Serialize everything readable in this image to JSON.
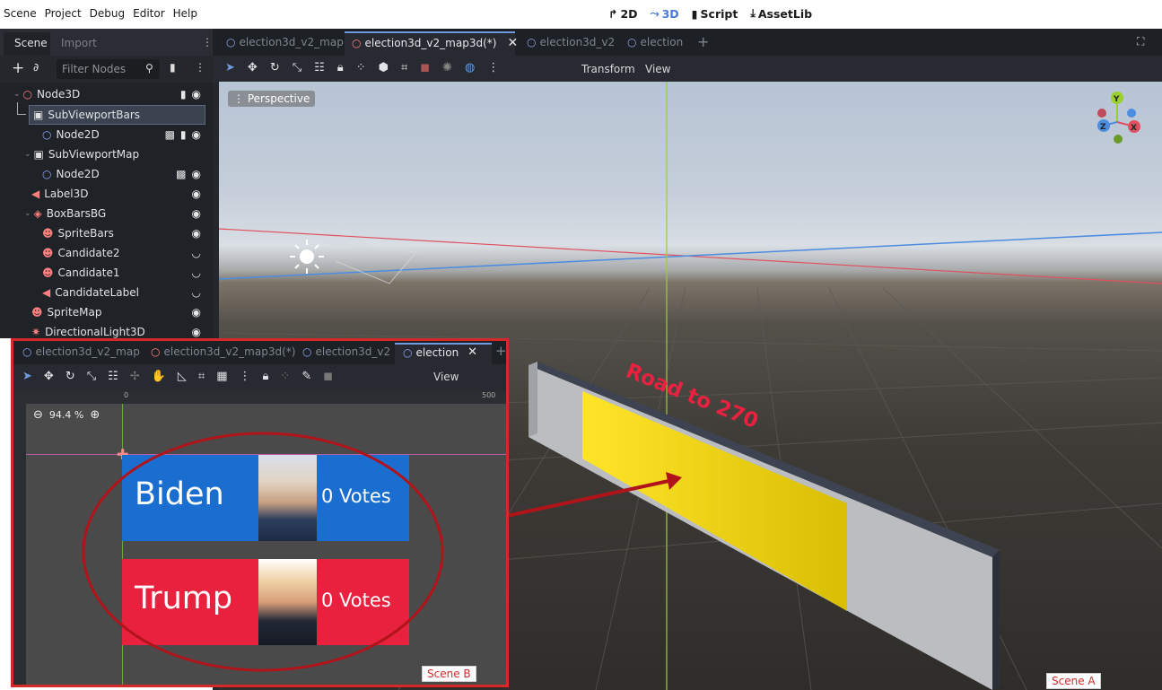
{
  "menubar": {
    "menus": [
      "Scene",
      "Project",
      "Debug",
      "Editor",
      "Help"
    ],
    "modes": [
      {
        "label": "2D",
        "icon": "2d-mode-icon",
        "active": false
      },
      {
        "label": "3D",
        "icon": "3d-mode-icon",
        "active": true
      },
      {
        "label": "Script",
        "icon": "script-icon",
        "active": false
      },
      {
        "label": "AssetLib",
        "icon": "assetlib-icon",
        "active": false
      }
    ]
  },
  "dock": {
    "tabs": [
      "Scene",
      "Import"
    ],
    "filter_placeholder": "Filter Nodes",
    "tree": [
      {
        "label": "Node3D",
        "icon": "node3d-icon",
        "icon_color": "#fc7f7f"
      },
      {
        "label": "SubViewportBars",
        "icon": "subviewport-icon",
        "icon_color": "#e0e0e0"
      },
      {
        "label": "Node2D",
        "icon": "node2d-icon",
        "icon_color": "#8da5f3"
      },
      {
        "label": "SubViewportMap",
        "icon": "subviewport-icon",
        "icon_color": "#e0e0e0"
      },
      {
        "label": "Node2D",
        "icon": "node2d-icon",
        "icon_color": "#8da5f3"
      },
      {
        "label": "Label3D",
        "icon": "label3d-icon",
        "icon_color": "#fc7f7f"
      },
      {
        "label": "BoxBarsBG",
        "icon": "csg-box-icon",
        "icon_color": "#fc7f7f"
      },
      {
        "label": "SpriteBars",
        "icon": "sprite3d-icon",
        "icon_color": "#fc7f7f"
      },
      {
        "label": "Candidate2",
        "icon": "sprite3d-icon",
        "icon_color": "#fc7f7f"
      },
      {
        "label": "Candidate1",
        "icon": "sprite3d-icon",
        "icon_color": "#fc7f7f"
      },
      {
        "label": "CandidateLabel",
        "icon": "label3d-icon",
        "icon_color": "#fc7f7f"
      },
      {
        "label": "SpriteMap",
        "icon": "sprite3d-icon",
        "icon_color": "#fc7f7f"
      },
      {
        "label": "DirectionalLight3D",
        "icon": "light-icon",
        "icon_color": "#fc7f7f"
      }
    ]
  },
  "editor3d": {
    "tabs": [
      {
        "label": "election3d_v2_map",
        "active": false
      },
      {
        "label": "election3d_v2_map3d(*)",
        "active": true
      },
      {
        "label": "election3d_v2",
        "active": false
      },
      {
        "label": "election",
        "active": false
      }
    ],
    "toolbar_menus": [
      "Transform",
      "View"
    ],
    "viewport_label": "Perspective",
    "gizmo": {
      "x": "X",
      "y": "Y",
      "z": "Z"
    },
    "board_label": "Road to 270",
    "scene_label": "Scene A"
  },
  "inset": {
    "tabs": [
      {
        "label": "election3d_v2_map",
        "active": false
      },
      {
        "label": "election3d_v2_map3d(*)",
        "active": false
      },
      {
        "label": "election3d_v2",
        "active": false
      },
      {
        "label": "election",
        "active": true
      }
    ],
    "toolbar_menu": "View",
    "zoom": "94.4 %",
    "ruler_zero": "0",
    "ruler_500": "500",
    "candidates": [
      {
        "name": "Biden",
        "votes": "0 Votes",
        "color": "#1a6ed0"
      },
      {
        "name": "Trump",
        "votes": "0 Votes",
        "color": "#e8213f"
      }
    ],
    "scene_label": "Scene B"
  },
  "colors": {
    "accent": "#4a7bd6",
    "annotation": "#d52828",
    "bar_fill": "#ffe003"
  }
}
